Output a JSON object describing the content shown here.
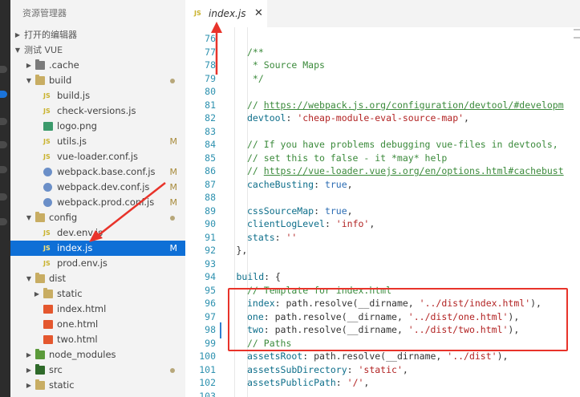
{
  "explorer": {
    "title": "资源管理器",
    "open_editors": "打开的编辑器",
    "project": "测试 VUE",
    "tree": [
      {
        "label": ".cache",
        "kind": "folder",
        "color": "dark",
        "depth": 1,
        "open": false
      },
      {
        "label": "build",
        "kind": "folder",
        "color": "normal",
        "depth": 1,
        "open": true,
        "dot": true
      },
      {
        "label": "build.js",
        "kind": "js",
        "depth": 2
      },
      {
        "label": "check-versions.js",
        "kind": "js",
        "depth": 2
      },
      {
        "label": "logo.png",
        "kind": "img",
        "depth": 2
      },
      {
        "label": "utils.js",
        "kind": "js",
        "depth": 2,
        "badge": "M"
      },
      {
        "label": "vue-loader.conf.js",
        "kind": "js",
        "depth": 2
      },
      {
        "label": "webpack.base.conf.js",
        "kind": "gear",
        "depth": 2,
        "badge": "M"
      },
      {
        "label": "webpack.dev.conf.js",
        "kind": "gear",
        "depth": 2,
        "badge": "M"
      },
      {
        "label": "webpack.prod.conf.js",
        "kind": "gear",
        "depth": 2,
        "badge": "M"
      },
      {
        "label": "config",
        "kind": "folder",
        "color": "normal",
        "depth": 1,
        "open": true,
        "dot": true
      },
      {
        "label": "dev.env.js",
        "kind": "js",
        "depth": 2
      },
      {
        "label": "index.js",
        "kind": "js",
        "depth": 2,
        "badge": "M",
        "selected": true
      },
      {
        "label": "prod.env.js",
        "kind": "js",
        "depth": 2
      },
      {
        "label": "dist",
        "kind": "folder",
        "color": "normal",
        "depth": 1,
        "open": true
      },
      {
        "label": "static",
        "kind": "folder",
        "color": "normal",
        "depth": 2,
        "open": false
      },
      {
        "label": "index.html",
        "kind": "html",
        "depth": 2
      },
      {
        "label": "one.html",
        "kind": "html",
        "depth": 2
      },
      {
        "label": "two.html",
        "kind": "html",
        "depth": 2
      },
      {
        "label": "node_modules",
        "kind": "folder",
        "color": "green",
        "depth": 1,
        "open": false
      },
      {
        "label": "src",
        "kind": "folder",
        "color": "darkgreen",
        "depth": 1,
        "open": false,
        "dot": true
      },
      {
        "label": "static",
        "kind": "folder",
        "color": "normal",
        "depth": 1,
        "open": false
      }
    ]
  },
  "editor": {
    "tab": {
      "icon_text": "JS",
      "label": "index.js",
      "close": "✕"
    },
    "lines": [
      {
        "n": "76",
        "indent": 0,
        "tokens": []
      },
      {
        "n": "77",
        "indent": 2,
        "tokens": [
          [
            "c",
            "/**"
          ]
        ]
      },
      {
        "n": "78",
        "indent": 2,
        "tokens": [
          [
            "c",
            " * Source Maps"
          ]
        ]
      },
      {
        "n": "79",
        "indent": 2,
        "tokens": [
          [
            "c",
            " */"
          ]
        ]
      },
      {
        "n": "80",
        "indent": 0,
        "tokens": []
      },
      {
        "n": "81",
        "indent": 2,
        "tokens": [
          [
            "c",
            "// "
          ],
          [
            "url",
            "https://webpack.js.org/configuration/devtool/#developm"
          ]
        ]
      },
      {
        "n": "82",
        "indent": 2,
        "tokens": [
          [
            "k",
            "devtool"
          ],
          [
            "p",
            ": "
          ],
          [
            "s",
            "'cheap-module-eval-source-map'"
          ],
          [
            "p",
            ","
          ]
        ]
      },
      {
        "n": "83",
        "indent": 0,
        "tokens": []
      },
      {
        "n": "84",
        "indent": 2,
        "tokens": [
          [
            "c",
            "// If you have problems debugging vue-files in devtools,"
          ]
        ]
      },
      {
        "n": "85",
        "indent": 2,
        "tokens": [
          [
            "c",
            "// set this to false - it *may* help"
          ]
        ]
      },
      {
        "n": "86",
        "indent": 2,
        "tokens": [
          [
            "c",
            "// "
          ],
          [
            "url",
            "https://vue-loader.vuejs.org/en/options.html#cachebust"
          ]
        ]
      },
      {
        "n": "87",
        "indent": 2,
        "tokens": [
          [
            "k",
            "cacheBusting"
          ],
          [
            "p",
            ": "
          ],
          [
            "kw",
            "true"
          ],
          [
            "p",
            ","
          ]
        ]
      },
      {
        "n": "88",
        "indent": 0,
        "tokens": []
      },
      {
        "n": "89",
        "indent": 2,
        "tokens": [
          [
            "k",
            "cssSourceMap"
          ],
          [
            "p",
            ": "
          ],
          [
            "kw",
            "true"
          ],
          [
            "p",
            ","
          ]
        ]
      },
      {
        "n": "90",
        "indent": 2,
        "tokens": [
          [
            "k",
            "clientLogLevel"
          ],
          [
            "p",
            ": "
          ],
          [
            "s",
            "'info'"
          ],
          [
            "p",
            ","
          ]
        ]
      },
      {
        "n": "91",
        "indent": 2,
        "tokens": [
          [
            "k",
            "stats"
          ],
          [
            "p",
            ": "
          ],
          [
            "s",
            "''"
          ]
        ]
      },
      {
        "n": "92",
        "indent": 1,
        "tokens": [
          [
            "p",
            "},"
          ]
        ]
      },
      {
        "n": "93",
        "indent": 0,
        "tokens": []
      },
      {
        "n": "94",
        "indent": 1,
        "tokens": [
          [
            "k",
            "build"
          ],
          [
            "p",
            ": {"
          ]
        ]
      },
      {
        "n": "95",
        "indent": 2,
        "tokens": [
          [
            "c",
            "// Template for index.html"
          ]
        ]
      },
      {
        "n": "96",
        "indent": 2,
        "tokens": [
          [
            "k",
            "index"
          ],
          [
            "p",
            ": path.resolve(__dirname, "
          ],
          [
            "s",
            "'../dist/index.html'"
          ],
          [
            "p",
            "),"
          ]
        ]
      },
      {
        "n": "97",
        "indent": 2,
        "tokens": [
          [
            "k",
            "one"
          ],
          [
            "p",
            ": path.resolve(__dirname, "
          ],
          [
            "s",
            "'../dist/one.html'"
          ],
          [
            "p",
            "),"
          ]
        ]
      },
      {
        "n": "98",
        "indent": 2,
        "tokens": [
          [
            "k",
            "two"
          ],
          [
            "p",
            ": path.resolve(__dirname, "
          ],
          [
            "s",
            "'../dist/two.html'"
          ],
          [
            "p",
            "),"
          ]
        ]
      },
      {
        "n": "99",
        "indent": 2,
        "tokens": [
          [
            "c",
            "// Paths"
          ]
        ]
      },
      {
        "n": "100",
        "indent": 2,
        "tokens": [
          [
            "k",
            "assetsRoot"
          ],
          [
            "p",
            ": path.resolve(__dirname, "
          ],
          [
            "s",
            "'../dist'"
          ],
          [
            "p",
            "),"
          ]
        ]
      },
      {
        "n": "101",
        "indent": 2,
        "tokens": [
          [
            "k",
            "assetsSubDirectory"
          ],
          [
            "p",
            ": "
          ],
          [
            "s",
            "'static'"
          ],
          [
            "p",
            ","
          ]
        ]
      },
      {
        "n": "102",
        "indent": 2,
        "tokens": [
          [
            "k",
            "assetsPublicPath"
          ],
          [
            "p",
            ": "
          ],
          [
            "s",
            "'/'"
          ],
          [
            "p",
            ","
          ]
        ]
      },
      {
        "n": "103",
        "indent": 0,
        "tokens": []
      }
    ]
  },
  "colors": {
    "selection": "#0e6fd6",
    "annotation_red": "#e8332a",
    "modified_badge": "#a88b3c"
  }
}
